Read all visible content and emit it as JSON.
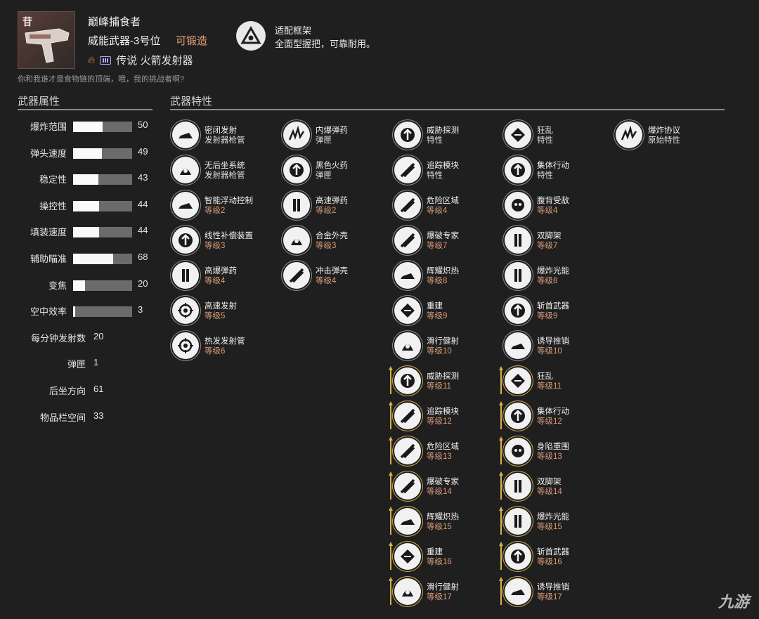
{
  "weapon": {
    "icon_tag": "苷",
    "name": "巅峰捕食者",
    "type": "威能武器-3号位",
    "craftable": "可锻造",
    "element_icon": "flame-icon",
    "ammo_icon": "heavy-ammo-icon",
    "rarity_type": "传说 火箭发射器",
    "flavor": "你和我谁才是食物链的顶端，哦，我的挑战者啊?"
  },
  "frame": {
    "icon": "frame-triangle-icon",
    "title": "适配框架",
    "description": "全面型握把，可靠耐用。"
  },
  "sections": {
    "stats_title": "武器属性",
    "perks_title": "武器特性"
  },
  "stats_bar": [
    {
      "label": "爆炸范围",
      "value": 50
    },
    {
      "label": "弹头速度",
      "value": 49
    },
    {
      "label": "稳定性",
      "value": 43
    },
    {
      "label": "操控性",
      "value": 44
    },
    {
      "label": "填装速度",
      "value": 44
    },
    {
      "label": "辅助瞄准",
      "value": 68
    },
    {
      "label": "变焦",
      "value": 20
    },
    {
      "label": "空中效率",
      "value": 3
    }
  ],
  "stats_plain": [
    {
      "label": "每分钟发射数",
      "value": "20"
    },
    {
      "label": "弹匣",
      "value": "1"
    },
    {
      "label": "后坐方向",
      "value": "61"
    },
    {
      "label": "物品栏空间",
      "value": "33"
    }
  ],
  "perk_columns": [
    [
      {
        "name": "密闭发射",
        "sub": "发射器枪管",
        "icon": "sealed-launcher-icon",
        "level": false,
        "enhanced": false
      },
      {
        "name": "无后坐系统",
        "sub": "发射器枪管",
        "icon": "recoilless-icon",
        "level": false,
        "enhanced": false
      },
      {
        "name": "智能浮动控制",
        "sub": "等级2",
        "icon": "smart-drift-icon",
        "level": true,
        "enhanced": false
      },
      {
        "name": "线性补偿装置",
        "sub": "等级3",
        "icon": "linear-compensator-icon",
        "level": true,
        "enhanced": false
      },
      {
        "name": "高爆弹药",
        "sub": "等级4",
        "icon": "high-explosive-icon",
        "level": true,
        "enhanced": false
      },
      {
        "name": "高速发射",
        "sub": "等级5",
        "icon": "quick-launch-icon",
        "level": true,
        "enhanced": false
      },
      {
        "name": "热发发射管",
        "sub": "等级6",
        "icon": "hard-launch-icon",
        "level": true,
        "enhanced": false
      }
    ],
    [
      {
        "name": "内爆弹药",
        "sub": "弹匣",
        "icon": "implosion-rounds-icon",
        "level": false,
        "enhanced": false
      },
      {
        "name": "黑色火药",
        "sub": "弹匣",
        "icon": "black-powder-icon",
        "level": false,
        "enhanced": false
      },
      {
        "name": "高速弹药",
        "sub": "等级2",
        "icon": "high-velocity-icon",
        "level": true,
        "enhanced": false
      },
      {
        "name": "合金外壳",
        "sub": "等级3",
        "icon": "alloy-casing-icon",
        "level": true,
        "enhanced": false
      },
      {
        "name": "冲击弹壳",
        "sub": "等级4",
        "icon": "impact-casing-icon",
        "level": true,
        "enhanced": false
      }
    ],
    [
      {
        "name": "威胁探测",
        "sub": "特性",
        "icon": "threat-detector-icon",
        "level": false,
        "enhanced": false
      },
      {
        "name": "追踪模块",
        "sub": "特性",
        "icon": "tracking-module-icon",
        "level": false,
        "enhanced": false
      },
      {
        "name": "危险区域",
        "sub": "等级4",
        "icon": "danger-zone-icon",
        "level": true,
        "enhanced": false
      },
      {
        "name": "爆破专家",
        "sub": "等级7",
        "icon": "demolitionist-icon",
        "level": true,
        "enhanced": false
      },
      {
        "name": "辉耀炽热",
        "sub": "等级8",
        "icon": "incandescent-icon",
        "level": true,
        "enhanced": false
      },
      {
        "name": "重建",
        "sub": "等级9",
        "icon": "reconstruction-icon",
        "level": true,
        "enhanced": false
      },
      {
        "name": "滑行健射",
        "sub": "等级10",
        "icon": "slideshot-icon",
        "level": true,
        "enhanced": false
      },
      {
        "name": "威胁探测",
        "sub": "等级11",
        "icon": "threat-detector-icon",
        "level": true,
        "enhanced": true
      },
      {
        "name": "追踪模块",
        "sub": "等级12",
        "icon": "tracking-module-icon",
        "level": true,
        "enhanced": true
      },
      {
        "name": "危险区域",
        "sub": "等级13",
        "icon": "danger-zone-icon",
        "level": true,
        "enhanced": true
      },
      {
        "name": "爆破专家",
        "sub": "等级14",
        "icon": "demolitionist-icon",
        "level": true,
        "enhanced": true
      },
      {
        "name": "辉耀炽热",
        "sub": "等级15",
        "icon": "incandescent-icon",
        "level": true,
        "enhanced": true
      },
      {
        "name": "重建",
        "sub": "等级16",
        "icon": "reconstruction-icon",
        "level": true,
        "enhanced": true
      },
      {
        "name": "滑行健射",
        "sub": "等级17",
        "icon": "slideshot-icon",
        "level": true,
        "enhanced": true
      }
    ],
    [
      {
        "name": "狂乱",
        "sub": "特性",
        "icon": "frenzy-icon",
        "level": false,
        "enhanced": false
      },
      {
        "name": "集体行动",
        "sub": "特性",
        "icon": "collective-action-icon",
        "level": false,
        "enhanced": false
      },
      {
        "name": "腹背受敌",
        "sub": "等级4",
        "icon": "surrounded-icon",
        "level": true,
        "enhanced": false
      },
      {
        "name": "双脚架",
        "sub": "等级7",
        "icon": "bipod-icon",
        "level": true,
        "enhanced": false
      },
      {
        "name": "爆炸光能",
        "sub": "等级8",
        "icon": "explosive-light-icon",
        "level": true,
        "enhanced": false
      },
      {
        "name": "斩首武器",
        "sub": "等级9",
        "icon": "executioner-icon",
        "level": true,
        "enhanced": false
      },
      {
        "name": "诱导推销",
        "sub": "等级10",
        "icon": "bait-and-switch-icon",
        "level": true,
        "enhanced": false
      },
      {
        "name": "狂乱",
        "sub": "等级11",
        "icon": "frenzy-icon",
        "level": true,
        "enhanced": true
      },
      {
        "name": "集体行动",
        "sub": "等级12",
        "icon": "collective-action-icon",
        "level": true,
        "enhanced": true
      },
      {
        "name": "身陷重围",
        "sub": "等级13",
        "icon": "surrounded-icon",
        "level": true,
        "enhanced": true
      },
      {
        "name": "双脚架",
        "sub": "等级14",
        "icon": "bipod-icon",
        "level": true,
        "enhanced": true
      },
      {
        "name": "爆炸光能",
        "sub": "等级15",
        "icon": "explosive-light-icon",
        "level": true,
        "enhanced": true
      },
      {
        "name": "斩首武器",
        "sub": "等级16",
        "icon": "executioner-icon",
        "level": true,
        "enhanced": true
      },
      {
        "name": "诱导推销",
        "sub": "等级17",
        "icon": "bait-and-switch-icon",
        "level": true,
        "enhanced": true
      }
    ],
    [
      {
        "name": "爆炸协议",
        "sub": "原始特性",
        "icon": "explosive-protocol-icon",
        "level": false,
        "enhanced": false
      }
    ]
  ],
  "colors": {
    "background": "#1f1f1f",
    "level_text": "#d99a7a",
    "craftable": "#e5a07c",
    "enhanced_ring": "#c9a54a"
  },
  "watermark": "九游"
}
